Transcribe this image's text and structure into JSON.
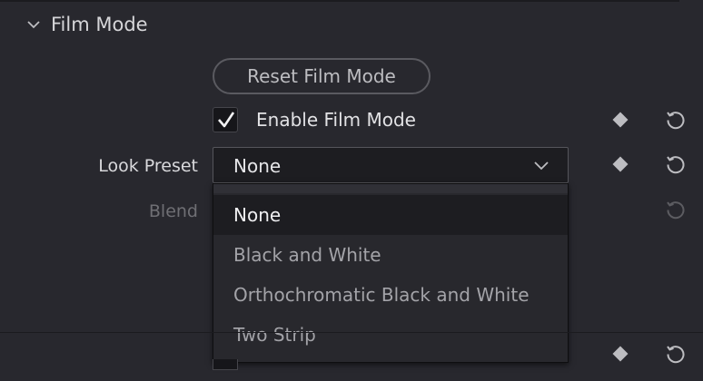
{
  "section": {
    "title": "Film Mode",
    "expanded": true
  },
  "reset_button": {
    "label": "Reset Film Mode"
  },
  "enable": {
    "label": "Enable Film Mode",
    "checked": true
  },
  "look_preset": {
    "label": "Look Preset",
    "value": "None",
    "options": [
      {
        "label": "None",
        "selected": true
      },
      {
        "label": "Black and White",
        "selected": false
      },
      {
        "label": "Orthochromatic Black and White",
        "selected": false
      },
      {
        "label": "Two Strip",
        "selected": false
      }
    ]
  },
  "blend": {
    "label": "Blend",
    "enabled": false
  },
  "icons": {
    "section_toggle": "chevron-down-icon",
    "checkbox": "checkmark-icon",
    "select_arrow": "chevron-down-icon",
    "keyframe": "keyframe-diamond-icon",
    "reset": "reset-icon"
  },
  "colors": {
    "background": "#28282e",
    "text": "#d9d9dc",
    "muted_text": "#a3a3a8",
    "disabled_text": "#6f6f74",
    "field_bg": "#1d1d21"
  }
}
